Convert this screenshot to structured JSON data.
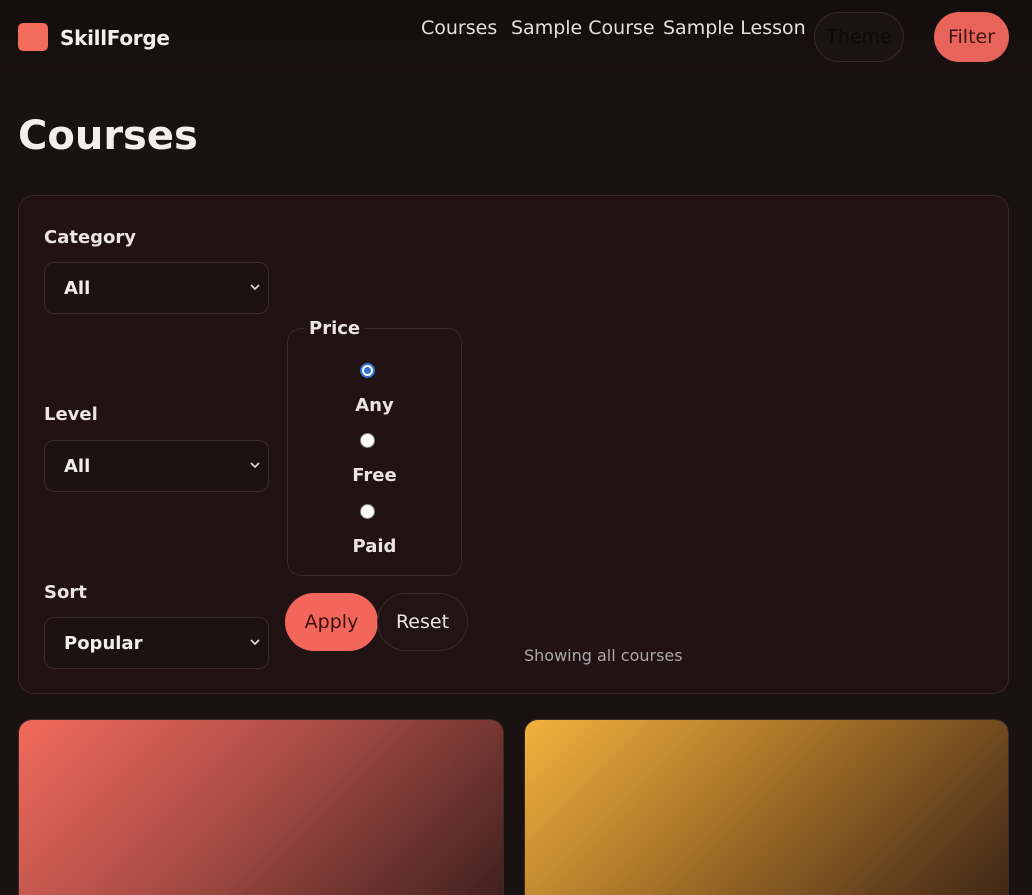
{
  "header": {
    "brand": "SkillForge",
    "nav": [
      "Courses",
      "Sample Course",
      "Sample Lesson"
    ],
    "theme_label": "Theme",
    "filter_label": "Filter"
  },
  "page": {
    "title": "Courses"
  },
  "filters": {
    "category": {
      "label": "Category",
      "value": "All"
    },
    "level": {
      "label": "Level",
      "value": "All"
    },
    "sort": {
      "label": "Sort",
      "value": "Popular"
    },
    "price": {
      "legend": "Price",
      "options": [
        "Any",
        "Free",
        "Paid"
      ],
      "selected": "Any"
    },
    "apply_label": "Apply",
    "reset_label": "Reset",
    "status": "Showing all courses"
  },
  "colors": {
    "accent": "#f26b5b",
    "background": "#1a1111",
    "panel": "#211313",
    "radio_checked": "#2d72d2"
  },
  "icons": {
    "logo": "logo-mark",
    "select": "chevron-down-icon"
  }
}
